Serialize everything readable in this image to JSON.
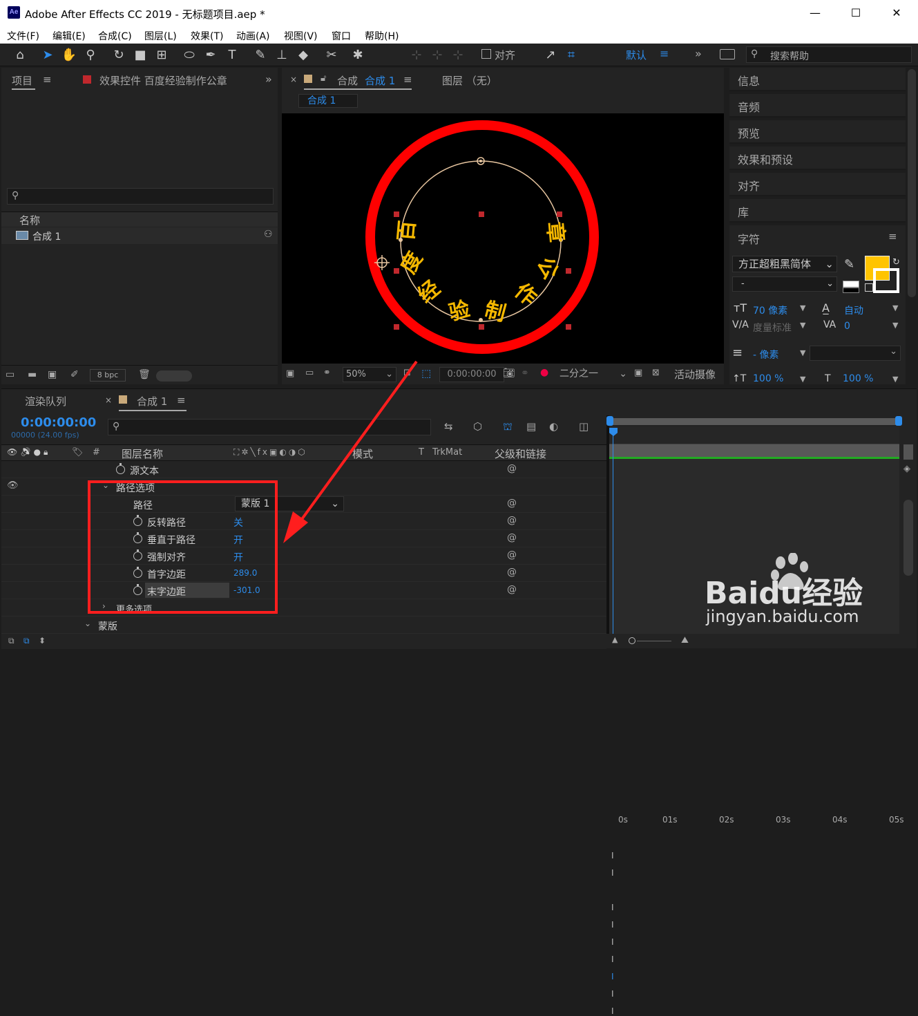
{
  "window": {
    "app_icon": "Ae",
    "title": "Adobe After Effects CC 2019 - 无标题项目.aep *",
    "minimize": "—",
    "maximize": "☐",
    "close": "✕"
  },
  "menu": [
    "文件(F)",
    "编辑(E)",
    "合成(C)",
    "图层(L)",
    "效果(T)",
    "动画(A)",
    "视图(V)",
    "窗口",
    "帮助(H)"
  ],
  "toolbar": {
    "align_label": "对齐",
    "workspace": "默认",
    "search_placeholder": "搜索帮助"
  },
  "project_panel": {
    "tab": "项目",
    "effects_tab": "效果控件 百度经验制作公章",
    "column_name": "名称",
    "items": [
      {
        "name": "合成 1"
      }
    ],
    "bpc": "8 bpc"
  },
  "comp_panel": {
    "tab_prefix": "合成",
    "tab_name": "合成 1",
    "layer_tab": "图层 （无）",
    "breadcrumb": "合成 1",
    "zoom": "50%",
    "timecode": "0:00:00:00",
    "resolution": "二分之一",
    "camera": "活动摄像"
  },
  "right_panels": [
    "信息",
    "音频",
    "预览",
    "效果和预设",
    "对齐",
    "库"
  ],
  "character": {
    "title": "字符",
    "font": "方正超粗黑简体",
    "style": "-",
    "size": "70 像素",
    "leading": "自动",
    "kerning": "度量标准",
    "tracking": "0",
    "stroke": "- 像素",
    "vscale": "100 %",
    "hscale": "100 %",
    "fill_color": "#ffc400"
  },
  "timeline": {
    "render_tab": "渲染队列",
    "comp_tab": "合成 1",
    "timecode": "0:00:00:00",
    "frames": "00000 (24.00 fps)",
    "col_layer_name": "图层名称",
    "col_mode": "模式",
    "col_t": "T",
    "col_trkmat": "TrkMat",
    "col_parent": "父级和链接",
    "rows": [
      {
        "label": "源文本",
        "value": ""
      },
      {
        "label": "路径选项",
        "value": ""
      },
      {
        "label": "路径",
        "value": "蒙版 1"
      },
      {
        "label": "反转路径",
        "value": "关"
      },
      {
        "label": "垂直于路径",
        "value": "开"
      },
      {
        "label": "强制对齐",
        "value": "开"
      },
      {
        "label": "首字边距",
        "value": "289.0"
      },
      {
        "label": "末字边距",
        "value": "-301.0"
      },
      {
        "label": "更多选项",
        "value": ""
      },
      {
        "label": "蒙版",
        "value": ""
      }
    ],
    "ruler": [
      "0s",
      "01s",
      "02s",
      "03s",
      "04s",
      "05s"
    ]
  },
  "comp_text": [
    "百",
    "度",
    "经",
    "验",
    "制",
    "作",
    "公",
    "章"
  ],
  "watermark": {
    "brand": "Baidu经验",
    "url": "jingyan.baidu.com"
  },
  "colors": {
    "accent": "#2d8ceb",
    "annotation": "#ff1e1e",
    "text_gold": "#f5b800"
  }
}
